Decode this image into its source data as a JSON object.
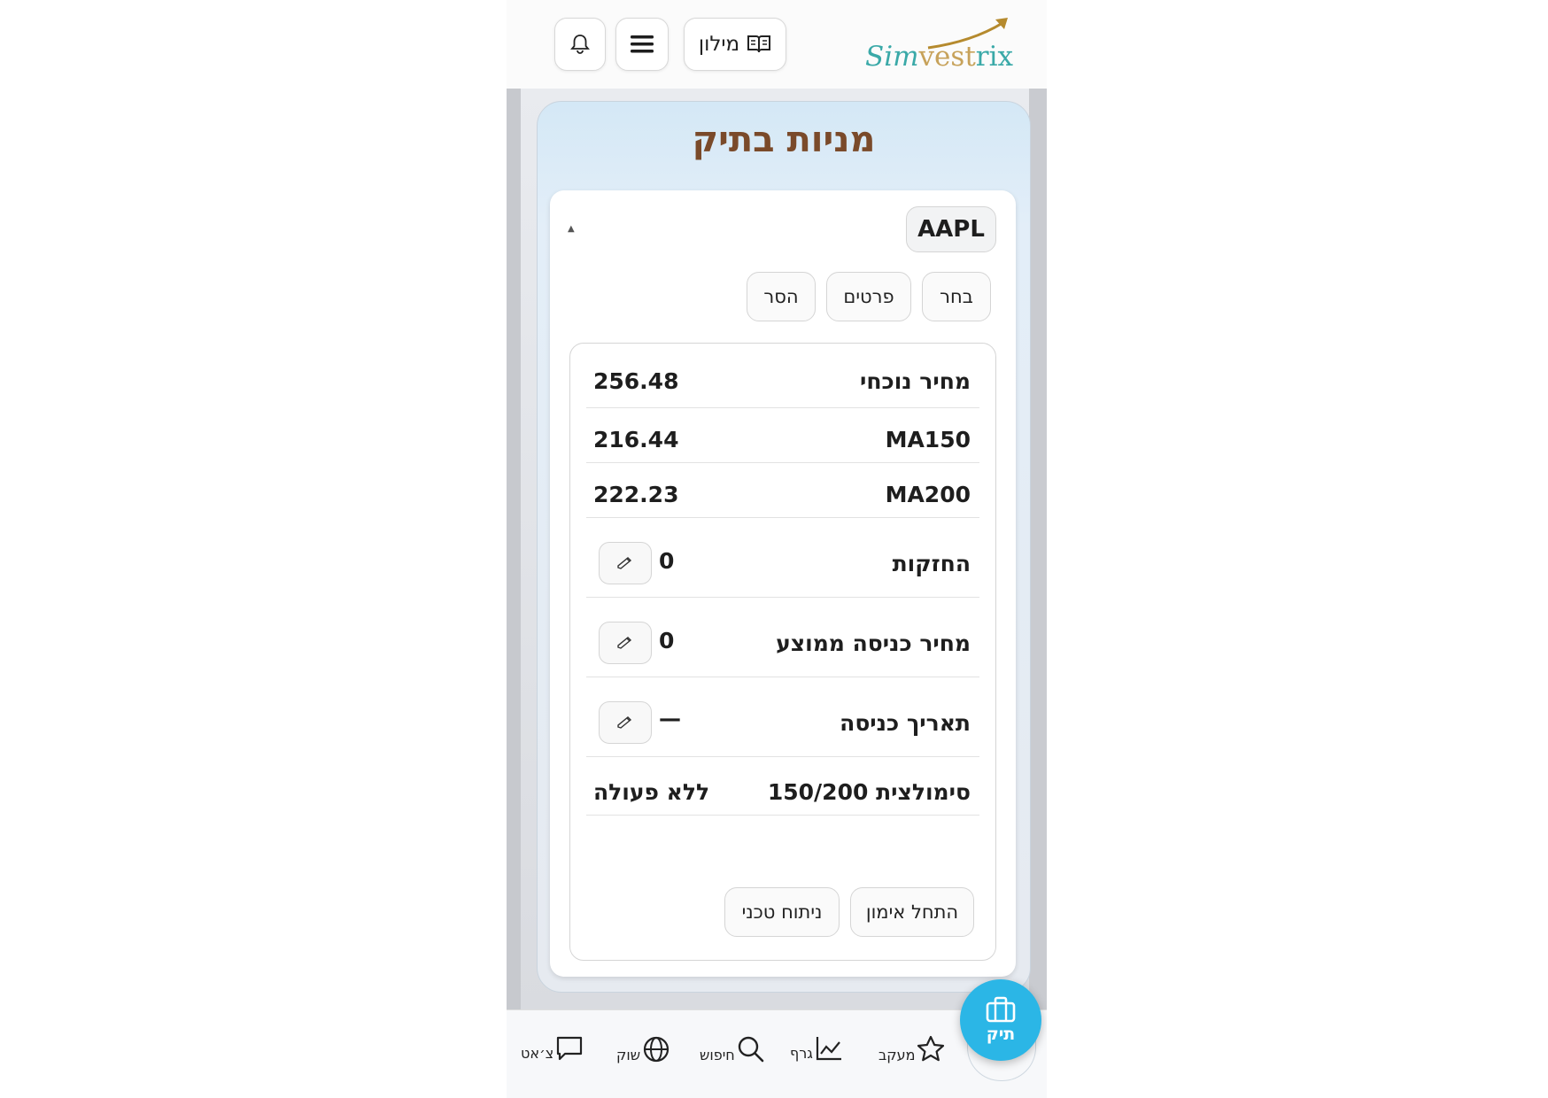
{
  "header": {
    "logo": {
      "part1": "Sim",
      "part2": "vest",
      "part3": "rix"
    },
    "dictionary_label": "מילון",
    "icons": {
      "dictionary": "open-book-icon",
      "menu": "hamburger-icon",
      "notifications": "bell-icon"
    }
  },
  "panel": {
    "title": "מניות בתיק"
  },
  "stock_card": {
    "ticker": "AAPL",
    "collapse_glyph": "▲",
    "actions": {
      "select": "בחר",
      "details": "פרטים",
      "remove": "הסר"
    },
    "rows": [
      {
        "label": "מחיר נוכחי",
        "value": "256.48"
      },
      {
        "label": "MA150",
        "value": "216.44"
      },
      {
        "label": "MA200",
        "value": "222.23"
      },
      {
        "label": "החזקות",
        "value": "0"
      },
      {
        "label": "מחיר כניסה ממוצע",
        "value": "0"
      },
      {
        "label": "תאריך כניסה",
        "value": "—"
      },
      {
        "label": "סימולצית 150/200",
        "value": "ללא פעולה"
      }
    ],
    "edit_icon": "pencil-icon",
    "buttons": {
      "start_training": "התחל אימון",
      "technical_analysis": "ניתוח טכני"
    }
  },
  "bottom_nav": {
    "items": [
      {
        "label": "צ׳אט",
        "icon": "chat-bubble-icon"
      },
      {
        "label": "שוק",
        "icon": "globe-icon"
      },
      {
        "label": "חיפוש",
        "icon": "search-icon"
      },
      {
        "label": "גרף",
        "icon": "chart-line-icon"
      },
      {
        "label": "מעקב",
        "icon": "star-icon"
      }
    ],
    "fab": {
      "label": "תיק",
      "icon": "briefcase-icon"
    }
  },
  "colors": {
    "accent": "#2bb6e6",
    "title_brown": "#7a4a2a",
    "logo_teal": "#3aa9a8",
    "logo_gold": "#c7a25a"
  }
}
